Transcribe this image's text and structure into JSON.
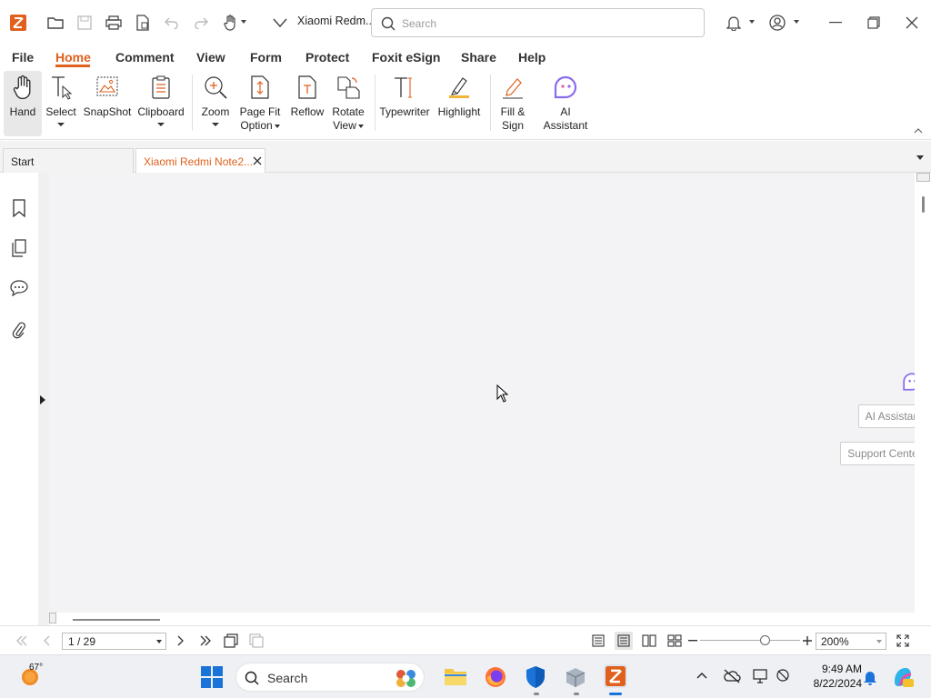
{
  "titlebar": {
    "doc_title": "Xiaomi Redm...",
    "search_placeholder": "Search"
  },
  "menu": {
    "items": [
      "File",
      "Home",
      "Comment",
      "View",
      "Form",
      "Protect",
      "Foxit eSign",
      "Share",
      "Help"
    ],
    "active": "Home"
  },
  "ribbon": {
    "hand": "Hand",
    "select": "Select",
    "snapshot": "SnapShot",
    "clipboard": "Clipboard",
    "zoom": "Zoom",
    "page_fit_1": "Page Fit",
    "page_fit_2": "Option",
    "reflow": "Reflow",
    "rotate_1": "Rotate",
    "rotate_2": "View",
    "typewriter": "Typewriter",
    "highlight": "Highlight",
    "fill_1": "Fill &",
    "fill_2": "Sign",
    "ai_1": "AI",
    "ai_2": "Assistant"
  },
  "tabs": {
    "start": "Start",
    "document": "Xiaomi Redmi Note2..."
  },
  "side_buttons": {
    "ai_assistant": "AI Assistant",
    "support_center": "Support Center"
  },
  "status": {
    "page": "1 / 29",
    "zoom": "200%"
  },
  "taskbar": {
    "weather_temp": "67°",
    "search_label": "Search",
    "time": "9:49 AM",
    "date": "8/22/2024"
  },
  "colors": {
    "accent": "#e0601e",
    "ai_purple": "#8a6cf0",
    "doc_bg": "#f3f3f5"
  }
}
